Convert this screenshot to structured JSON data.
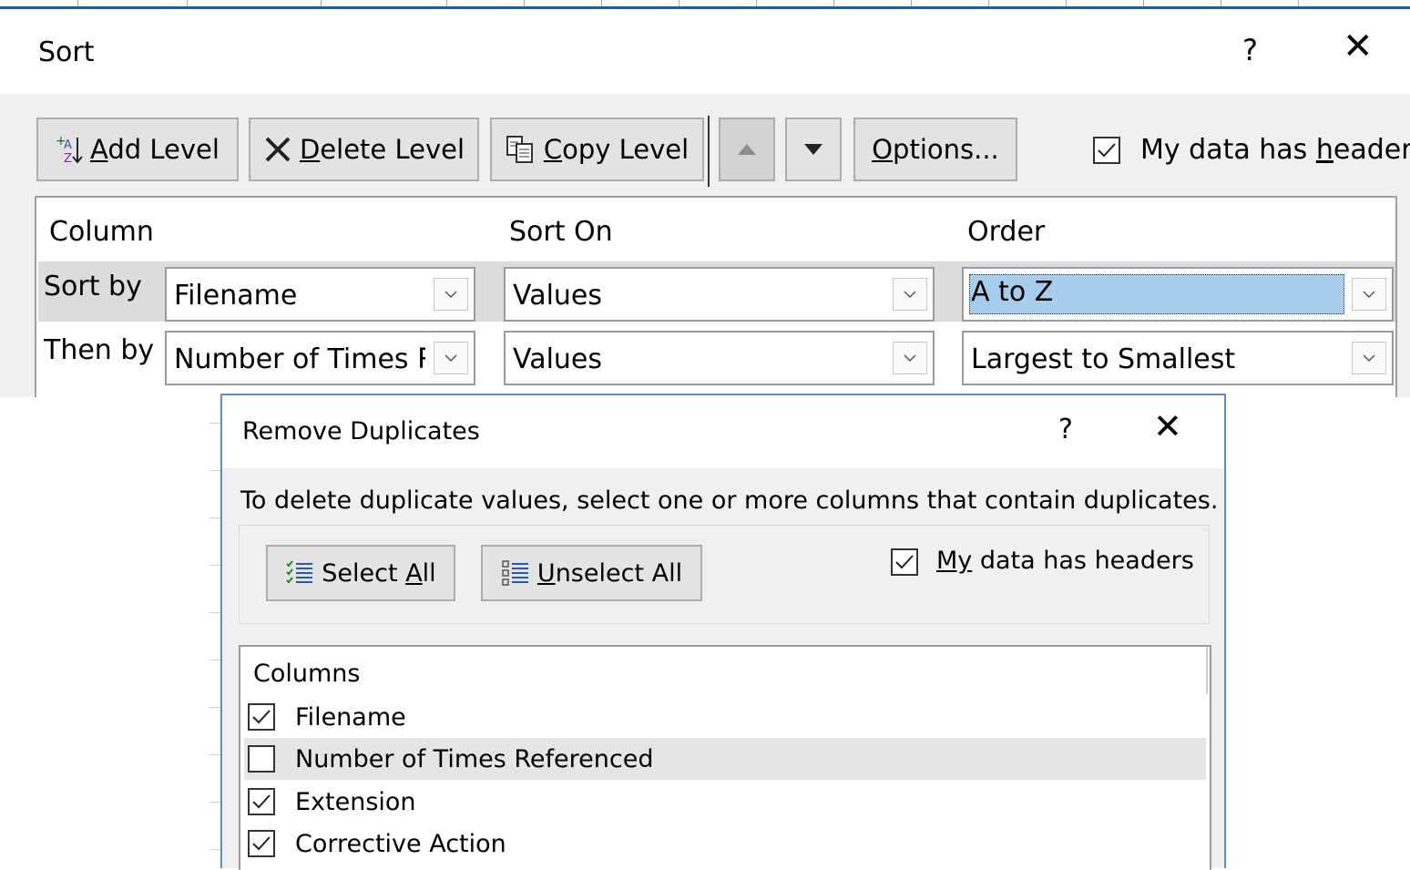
{
  "sort_dialog": {
    "title": "Sort",
    "help": "?",
    "close": "✕",
    "toolbar": {
      "add_level": {
        "key": "A",
        "rest": "dd Level"
      },
      "delete_level": {
        "key": "D",
        "rest": "elete Level"
      },
      "copy_level": {
        "key": "C",
        "rest": "opy Level"
      },
      "options": {
        "key": "O",
        "rest": "ptions..."
      }
    },
    "headers_checkbox": {
      "pre": "My data has ",
      "key": "h",
      "post": "eaders",
      "checked": true
    },
    "columns": {
      "column": "Column",
      "sort_on": "Sort On",
      "order": "Order"
    },
    "rows": [
      {
        "label": "Sort by",
        "column": "Filename",
        "sort_on": "Values",
        "order": "A to Z"
      },
      {
        "label": "Then by",
        "column": "Number of Times Referenced",
        "sort_on": "Values",
        "order": "Largest to Smallest"
      }
    ]
  },
  "remove_duplicates_dialog": {
    "title": "Remove Duplicates",
    "help": "?",
    "close": "✕",
    "instructions": "To delete duplicate values, select one or more columns that contain duplicates.",
    "select_all": {
      "pre": "Select ",
      "key": "A",
      "post": "ll"
    },
    "unselect_all": {
      "key": "U",
      "post": "nselect All"
    },
    "headers_checkbox": {
      "key": "My",
      "post": " data has headers",
      "checked": true
    },
    "columns_header": "Columns",
    "columns": [
      {
        "name": "Filename",
        "checked": true
      },
      {
        "name": "Number of Times Referenced",
        "checked": false
      },
      {
        "name": "Extension",
        "checked": true
      },
      {
        "name": "Corrective Action",
        "checked": true
      }
    ]
  },
  "colors": {
    "selection_highlight": "#a8cdec",
    "dialog_border": "#5e8ecb",
    "top_strip": "#1f5fa8"
  }
}
